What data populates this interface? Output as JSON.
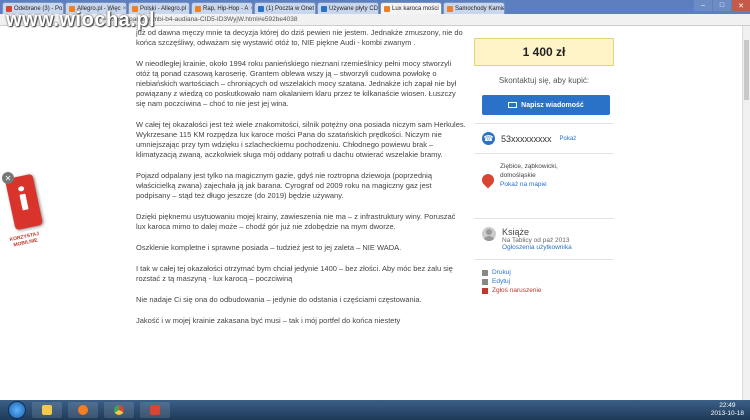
{
  "browser": {
    "tabs": [
      {
        "label": "Odebrane (3) - Po",
        "color": "#d84533",
        "active": false
      },
      {
        "label": "Allegro.pl - Więc",
        "color": "#f47f20",
        "active": false
      },
      {
        "label": "Polski - Allegro.pl",
        "color": "#f47f20",
        "active": false
      },
      {
        "label": "Rap, Hip-Hop - A",
        "color": "#f47f20",
        "active": false
      },
      {
        "label": "(1) Poczta w Onet",
        "color": "#2a72c7",
        "active": false
      },
      {
        "label": "Używane płyty CD",
        "color": "#2a72c7",
        "active": false
      },
      {
        "label": "Lux karoca mości",
        "color": "#f47f20",
        "active": true
      },
      {
        "label": "Samochody Kamie",
        "color": "#f47f20",
        "active": false
      }
    ],
    "url": "...ości-pana-kombi-b4-audiana-CID5-ID3WyjW.html#e592be4038"
  },
  "watermark": "www.wiocha.pl",
  "article": {
    "paragraphs": [
      "już od dawna męczy mnie ta decyzja której do dziś pewien nie jestem. Jednakże zmuszony, nie do końca szczęśliwy, odważam się wystawić otóż to, NIE piękne Audi - kombi zwanym .",
      "W nieodległej krainie, około 1994 roku panieńskiego nieznani rzemieślnicy pełni mocy stworzyli otóż tą ponad czasową karoserię. Grantem oblewa wszy ją – stworzyli cudowna powłokę o niebiańskich wartościach – chroniących od wszelakich mocy szatana. Jednakże ich zapał nie był powiązany z wiedzą co poskutkowało nam okalaniem klaru przez te kilkanaście wiosen. Łuszczy się nam poczciwina – choć to nie jest jej wina.",
      "W całej tej okazałości jest też wiele znakomitości, silnik potężny ona posiada niczym sam Herkules. Wykrzesane 115 KM rozpędza lux karoce mości Pana do szatańskich prędkości. Niczym nie umniejszając przy tym wdzięku i szlacheckiemu pochodzeniu. Chłodnego powiewu brak – klimatyzacją zwaną, aczkolwiek sługa mój oddany potrafi u dachu otwierać wszelakie bramy.",
      "Pojazd odpalany jest tylko na magicznym gazie, gdyś nie roztropna dziewoja (poprzednią właścicielką zwana) zajechała ją jak barana. Cyrograf od 2009 roku na magiczny gaz jest podpisany – stąd też długo jeszcze (do 2019) będzie używany.",
      "Dzięki pięknemu usytuowaniu mojej krainy, zawieszenia nie ma – z infrastruktury winy. Poruszać lux karoca mimo to dalej może – chodź gór już nie zdobędzie na mym dworze.",
      "Oszklenie kompletne i sprawne posiada – tudzież jest to jej zaleta – NIE WADA.",
      "I tak w całej tej okazałości otrzymać bym chciał jedynie 1400 – bez złości. Aby móc bez żalu się rozstać z tą maszyną - lux karocą – poczciwiną",
      "Nie nadaje Ci się ona do odbudowania – jedynie do odstania i częściami częstowania.",
      "Jakość i w mojej krainie zakasana być musi – tak i mój portfel do końca niestety"
    ]
  },
  "sidebar": {
    "price": "1 400 zł",
    "contact_title": "Skontaktuj się, aby kupić:",
    "message_button": "Napisz wiadomość",
    "phone": "53xxxxxxxxx",
    "phone_show": "Pokaż",
    "location_lines": [
      "Ziębice, ząbkowicki,",
      "dolnośląskie"
    ],
    "location_map": "Pokaż na mapie",
    "seller_name": "Książe",
    "seller_since": "Na Tablicy od paź 2013",
    "seller_other": "Ogłoszenia użytkownika",
    "print": "Drukuj",
    "edit": "Edytuj",
    "report": "Zgłoś naruszenie"
  },
  "ad": {
    "close": "✕",
    "caption": "KORZYSTAJ MOBILNIE"
  },
  "taskbar": {
    "time": "22:49",
    "date": "2013-10-18"
  },
  "colors": {
    "accent": "#2a72c7",
    "price_bg": "#fff4c7",
    "danger": "#c0392b"
  }
}
